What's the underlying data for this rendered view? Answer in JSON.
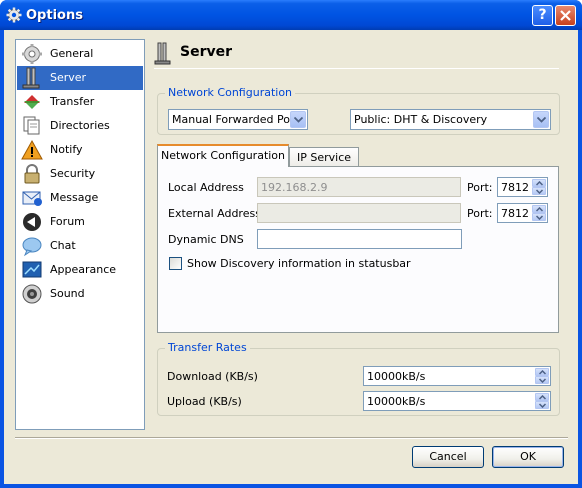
{
  "window": {
    "title": "Options"
  },
  "sidebar": {
    "items": [
      {
        "label": "General",
        "icon": "gear-icon"
      },
      {
        "label": "Server",
        "icon": "server-icon",
        "active": true
      },
      {
        "label": "Transfer",
        "icon": "transfer-icon"
      },
      {
        "label": "Directories",
        "icon": "directories-icon"
      },
      {
        "label": "Notify",
        "icon": "warning-icon"
      },
      {
        "label": "Security",
        "icon": "lock-icon"
      },
      {
        "label": "Message",
        "icon": "message-icon"
      },
      {
        "label": "Forum",
        "icon": "forum-icon"
      },
      {
        "label": "Chat",
        "icon": "chat-bubble-icon"
      },
      {
        "label": "Appearance",
        "icon": "appearance-icon"
      },
      {
        "label": "Sound",
        "icon": "speaker-icon"
      }
    ]
  },
  "page": {
    "title": "Server"
  },
  "network": {
    "group_title": "Network Configuration",
    "mode_value": "Manual Forwarded Port",
    "discovery_value": "Public: DHT & Discovery"
  },
  "tabs": [
    {
      "label": "Network Configuration",
      "active": true
    },
    {
      "label": "IP Service",
      "active": false
    }
  ],
  "network_tab": {
    "local_address_label": "Local Address",
    "local_address_value": "192.168.2.9",
    "external_address_label": "External Address",
    "external_address_value": "",
    "port_label": "Port:",
    "local_port": "7812",
    "external_port": "7812",
    "dynamic_dns_label": "Dynamic DNS",
    "dynamic_dns_value": "",
    "show_discovery_label": "Show Discovery information in statusbar",
    "show_discovery_checked": false
  },
  "transfer_rates": {
    "group_title": "Transfer Rates",
    "download_label": "Download (KB/s)",
    "download_value": "10000kB/s",
    "upload_label": "Upload (KB/s)",
    "upload_value": "10000kB/s"
  },
  "buttons": {
    "cancel": "Cancel",
    "ok": "OK"
  },
  "colors": {
    "selection": "#316ac5",
    "group_title": "#0046d5",
    "titlebar": "#0054e3"
  }
}
